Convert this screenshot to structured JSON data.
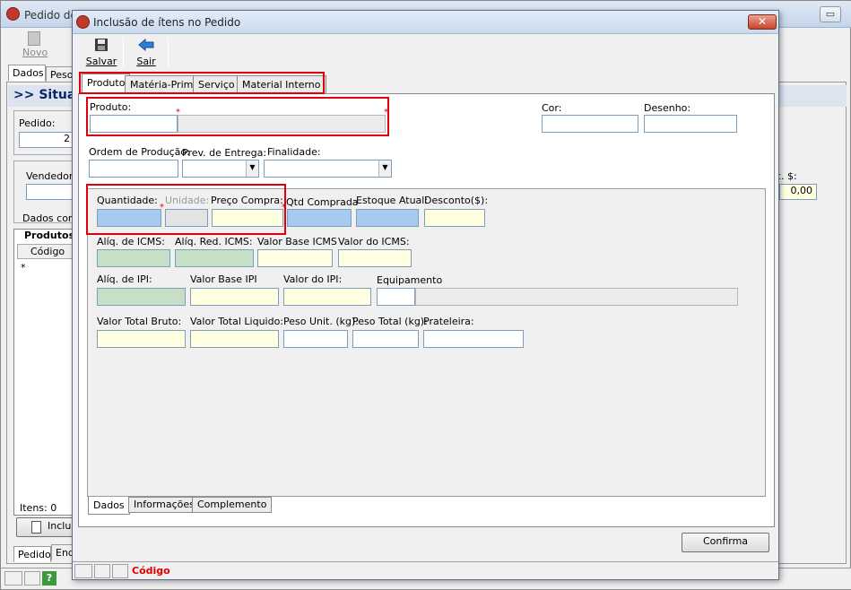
{
  "background_window": {
    "title": "Pedido de",
    "toolbar": {
      "novo_label": "Novo"
    },
    "tabs": [
      "Dados",
      "Peso"
    ],
    "situacao_header": ">> Situaç",
    "pedido_label": "Pedido:",
    "pedido_value": "2",
    "vendedor_label": "Vendedor",
    "dados_com_label": "Dados com",
    "produtos_label": "Produtos",
    "grid_header_codigo": "Código",
    "grid_row_marker": "*",
    "itens_label": "Itens: 0",
    "incluir_label": "Incluir",
    "bottom_tabs": [
      "Pedido",
      "End"
    ],
    "right_label": "c. $:",
    "right_value": "0,00",
    "status_help": "?"
  },
  "dialog": {
    "title": "Inclusão de ítens no Pedido",
    "close_symbol": "✕",
    "toolbar": {
      "salvar": "Salvar",
      "sair": "Sair"
    },
    "top_tabs": [
      "Produto",
      "Matéria-Prima",
      "Serviço",
      "Material Interno"
    ],
    "fields": {
      "produto": "Produto:",
      "cor": "Cor:",
      "desenho": "Desenho:",
      "ordem_producao": "Ordem de Produção:",
      "prev_entrega": "Prev. de Entrega:",
      "finalidade": "Finalidade:",
      "quantidade": "Quantidade:",
      "unidade": "Unidade:",
      "preco_compra": "Preço Compra:",
      "qtd_comprada": "Qtd Comprada",
      "estoque_atual": "Estoque Atual:",
      "desconto": "Desconto($):",
      "aliq_icms": "Alíq. de ICMS:",
      "aliq_red_icms": "Alíq. Red. ICMS:",
      "valor_base_icms": "Valor Base ICMS",
      "valor_icms": "Valor do ICMS:",
      "aliq_ipi": "Alíq. de IPI:",
      "valor_base_ipi": "Valor Base IPI",
      "valor_ipi": "Valor do IPI:",
      "equipamento": "Equipamento",
      "valor_total_bruto": "Valor Total Bruto:",
      "valor_total_liquido": "Valor Total Liquido:",
      "peso_unit": "Peso Unit. (kg):",
      "peso_total": "Peso Total (kg):",
      "prateleira": "Prateleira:"
    },
    "required_mark": "*",
    "bottom_tabs": [
      "Dados",
      "Informações",
      "Complemento"
    ],
    "confirm_button": "Confirma",
    "status_text": "Código"
  },
  "colors": {
    "highlight_red": "#e0000d",
    "field_yellow": "#ffffe1",
    "field_blue": "#a6caf0",
    "field_green": "#c6dfc6",
    "status_red": "#e00000"
  },
  "icons": [
    "app-icon",
    "floppy-disk-icon",
    "back-arrow-icon",
    "new-document-icon",
    "help-icon",
    "document-icon",
    "combo-arrow-icon"
  ]
}
